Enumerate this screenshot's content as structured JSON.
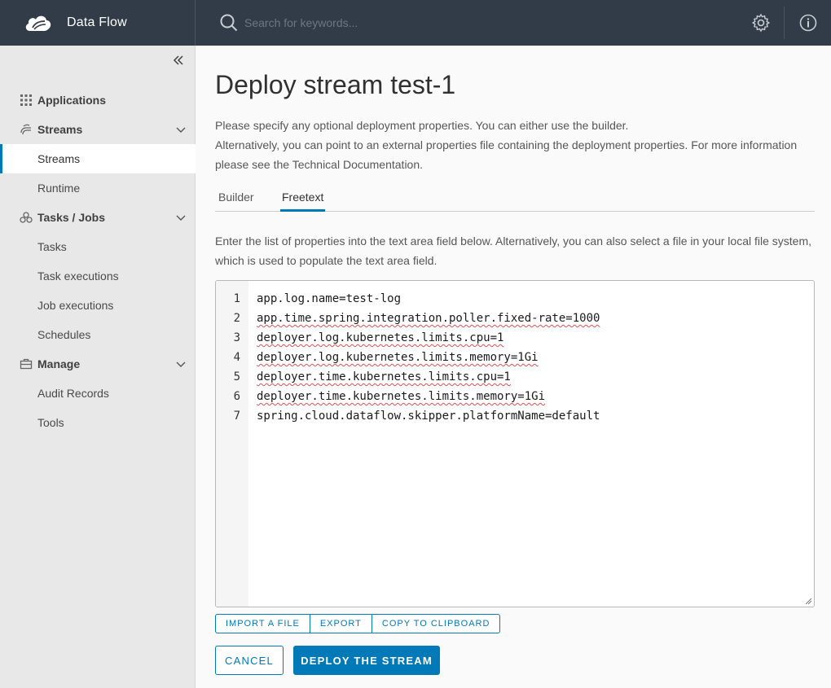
{
  "app": {
    "title": "Data Flow"
  },
  "search": {
    "placeholder": "Search for keywords..."
  },
  "sidebar": {
    "groups": [
      {
        "label": "Applications",
        "icon": "grid-icon"
      },
      {
        "label": "Streams",
        "icon": "streams-icon"
      },
      {
        "label": "Tasks / Jobs",
        "icon": "tasks-icon"
      },
      {
        "label": "Manage",
        "icon": "briefcase-icon"
      }
    ],
    "items": {
      "streams": "Streams",
      "runtime": "Runtime",
      "tasks": "Tasks",
      "task_executions": "Task executions",
      "job_executions": "Job executions",
      "schedules": "Schedules",
      "audit_records": "Audit Records",
      "tools": "Tools"
    }
  },
  "page": {
    "title": "Deploy stream test-1",
    "intro_line1": "Please specify any optional deployment properties. You can either use the builder.",
    "intro_line2": "Alternatively, you can point to an external properties file containing the deployment properties. For more information please see the Technical Documentation.",
    "tabs": [
      "Builder",
      "Freetext"
    ],
    "active_tab": "Freetext",
    "help": "Enter the list of properties into the text area field below. Alternatively, you can also select a file in your local file system, which is used to populate the text area field."
  },
  "editor": {
    "lines": [
      "app.log.name=test-log",
      "app.time.spring.integration.poller.fixed-rate=1000",
      "deployer.log.kubernetes.limits.cpu=1",
      "deployer.log.kubernetes.limits.memory=1Gi",
      "deployer.time.kubernetes.limits.cpu=1",
      "deployer.time.kubernetes.limits.memory=1Gi",
      "spring.cloud.dataflow.skipper.platformName=default"
    ],
    "line_numbers": [
      "1",
      "2",
      "3",
      "4",
      "5",
      "6",
      "7"
    ]
  },
  "buttons": {
    "import": "IMPORT A FILE",
    "export": "EXPORT",
    "copy": "COPY TO CLIPBOARD",
    "cancel": "CANCEL",
    "deploy": "DEPLOY THE STREAM"
  },
  "colors": {
    "header_bg": "#313c48",
    "accent": "#0079b8",
    "sidebar_bg": "#e8e8e8"
  }
}
